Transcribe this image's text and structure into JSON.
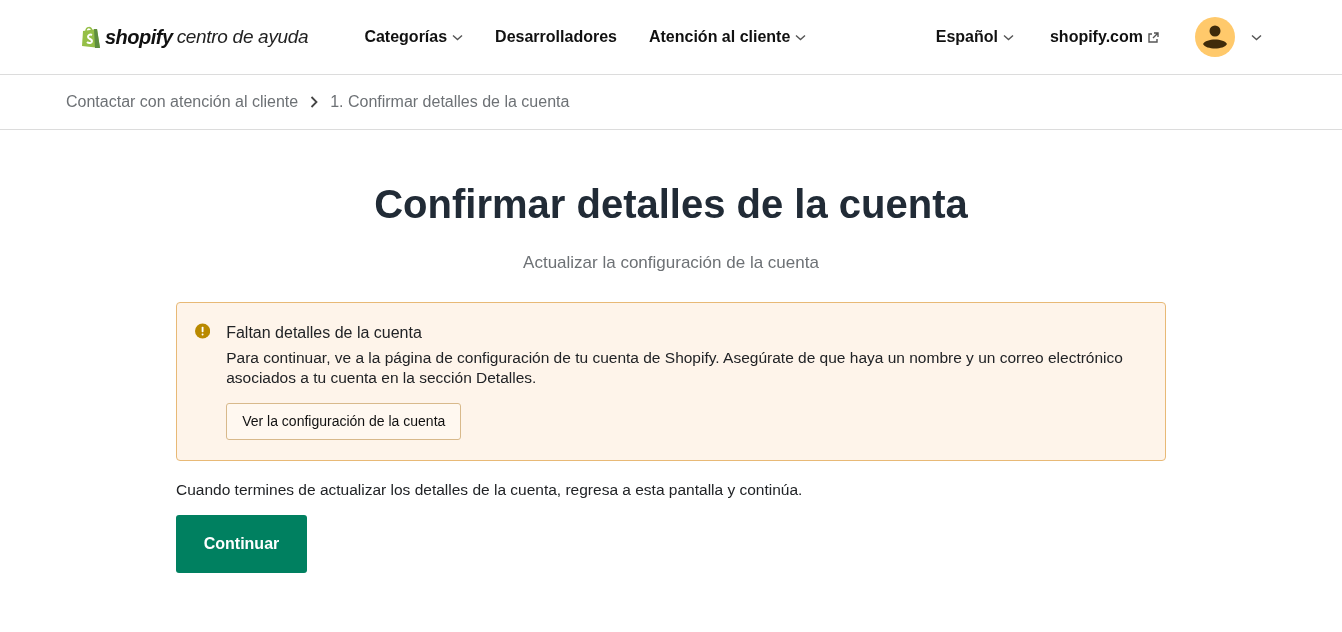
{
  "header": {
    "logo": {
      "brand": "shopify",
      "subtitle": "centro de ayuda"
    },
    "nav": [
      {
        "label": "Categorías",
        "kind": "dropdown"
      },
      {
        "label": "Desarrolladores",
        "kind": "link"
      },
      {
        "label": "Atención al cliente",
        "kind": "dropdown"
      }
    ],
    "right_nav": [
      {
        "label": "Español",
        "kind": "dropdown"
      },
      {
        "label": "shopify.com",
        "kind": "external"
      }
    ],
    "account_menu": {
      "kind": "avatar"
    }
  },
  "breadcrumb": [
    "Contactar con atención al cliente",
    "1. Confirmar detalles de la cuenta"
  ],
  "page": {
    "title": "Confirmar detalles de la cuenta",
    "subtitle": "Actualizar la configuración de la cuenta",
    "banner": {
      "kind": "warning",
      "title": "Faltan detalles de la cuenta",
      "message": "Para continuar, ve a la página de configuración de tu cuenta de Shopify. Asegúrate de que haya un nombre y un correo electrónico asociados a tu cuenta en la sección Detalles.",
      "button": "Ver la configuración de la cuenta"
    },
    "note": "Cuando termines de actualizar los detalles de la cuenta, regresa a esta pantalla y continúa.",
    "primary_button": "Continuar"
  }
}
